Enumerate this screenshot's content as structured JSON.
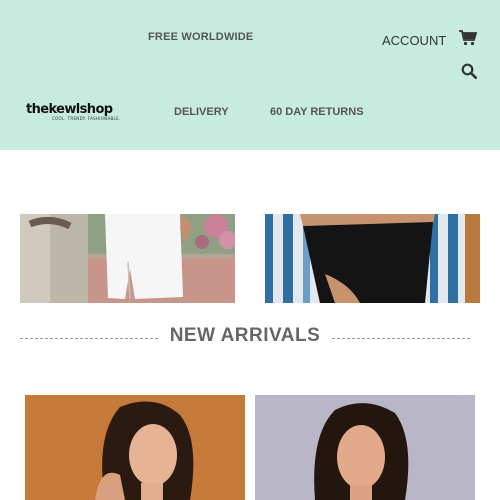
{
  "header": {
    "promo_text": "FREE WORLDWIDE",
    "account_label": "ACCOUNT",
    "cart_icon": "cart-icon",
    "search_icon": "search-icon",
    "logo": {
      "name": "thekewlshop",
      "tagline": "COOL. TRENDY. FASHIONABLE."
    },
    "nav": [
      {
        "label": "DELIVERY"
      },
      {
        "label": "60 DAY RETURNS"
      }
    ],
    "background": "#c8ebe0"
  },
  "section": {
    "title": "NEW ARRIVALS"
  }
}
